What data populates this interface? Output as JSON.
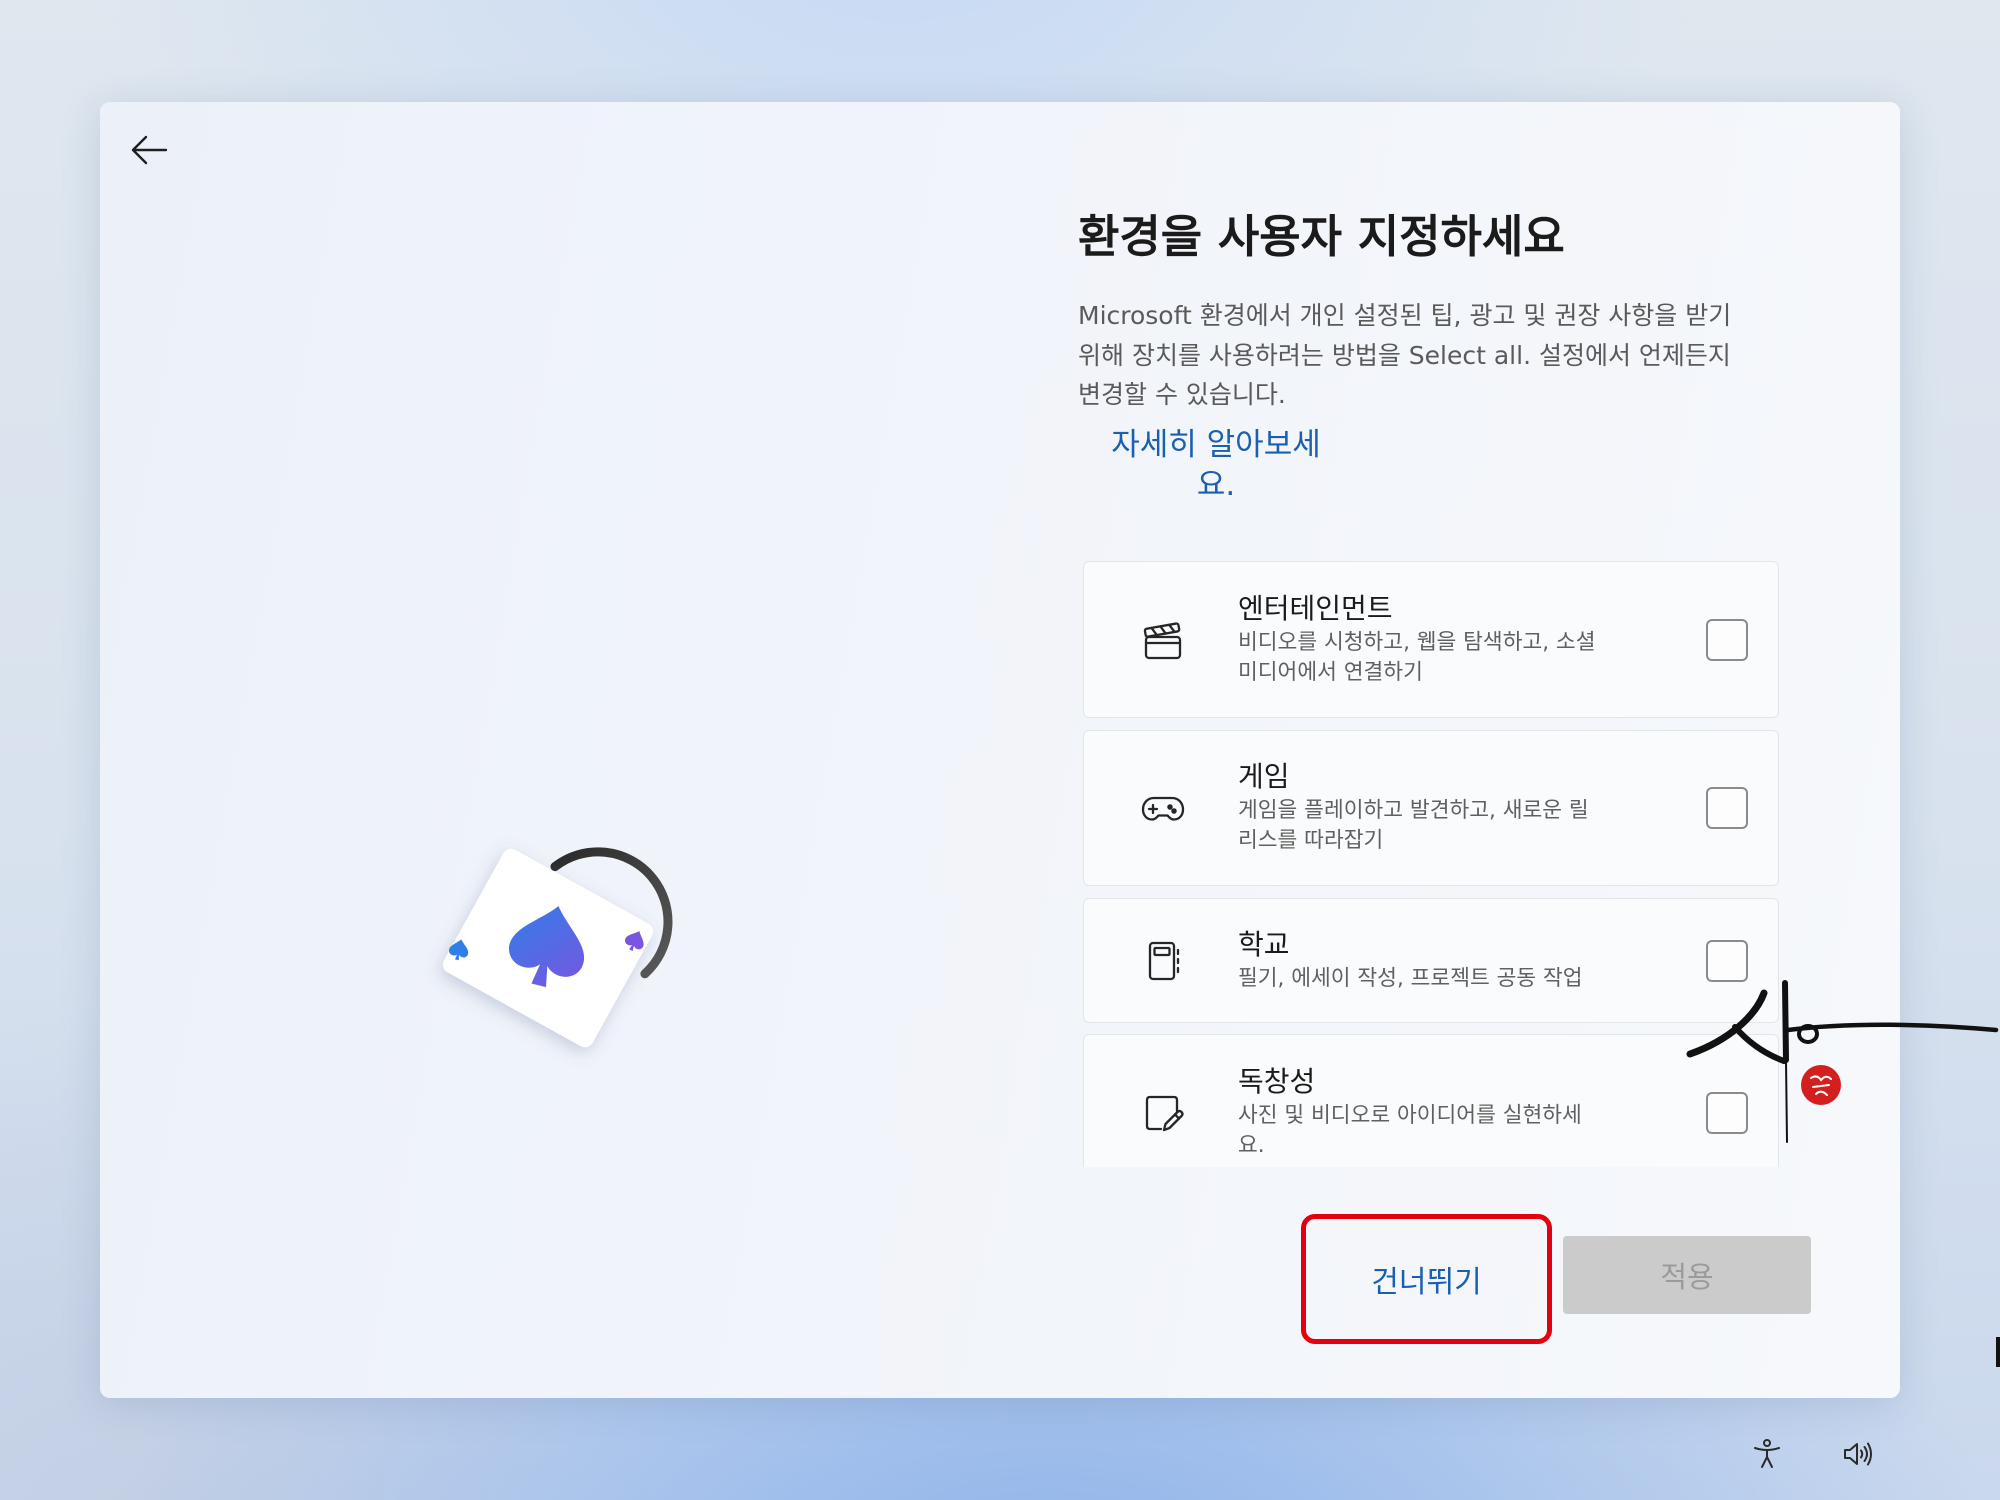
{
  "header": {
    "back_icon": "arrow-left-icon",
    "title": "환경을 사용자 지정하세요",
    "description_lines": [
      "Microsoft 환경에서 개인 설정된 팁, 광고 및 권장 사항을 받기",
      "위해 장치를 사용하려는 방법을 Select all. 설정에서 언제든지",
      "변경할 수 있습니다."
    ],
    "learn_more_lines": [
      "자세히 알아보세",
      "요."
    ]
  },
  "illustration": {
    "icon": "playing-card-spade-icon"
  },
  "options": [
    {
      "title": "엔터테인먼트",
      "description_lines": [
        "비디오를 시청하고, 웹을 탐색하고, 소셜",
        "미디어에서 연결하기"
      ],
      "icon": "clapperboard-icon",
      "checked": false
    },
    {
      "title": "게임",
      "description_lines": [
        "게임을 플레이하고 발견하고, 새로운 릴",
        "리스를 따라잡기"
      ],
      "icon": "game-controller-icon",
      "checked": false
    },
    {
      "title": "학교",
      "description_lines": [
        "필기, 에세이 작성, 프로젝트 공동 작업"
      ],
      "icon": "notebook-icon",
      "checked": false
    },
    {
      "title": "독창성",
      "description_lines": [
        "사진 및 비디오로 아이디어를 실현하세",
        "요."
      ],
      "icon": "sticky-note-pen-icon",
      "checked": false
    }
  ],
  "buttons": {
    "skip_label": "건너뛰기",
    "apply_label": "적용",
    "apply_enabled": false
  },
  "watermark": {
    "icon": "handwritten-signature-seal-icon"
  },
  "taskbar": {
    "icons": [
      "accessibility-icon",
      "volume-icon"
    ]
  },
  "colors": {
    "link": "#1b5fb0",
    "highlight": "#e3000f",
    "disabled_bg": "#cbcbcb",
    "disabled_text": "#9b9b9b",
    "spade_start": "#2f7fe8",
    "spade_end": "#7a55e0",
    "seal": "#d41f1f"
  }
}
